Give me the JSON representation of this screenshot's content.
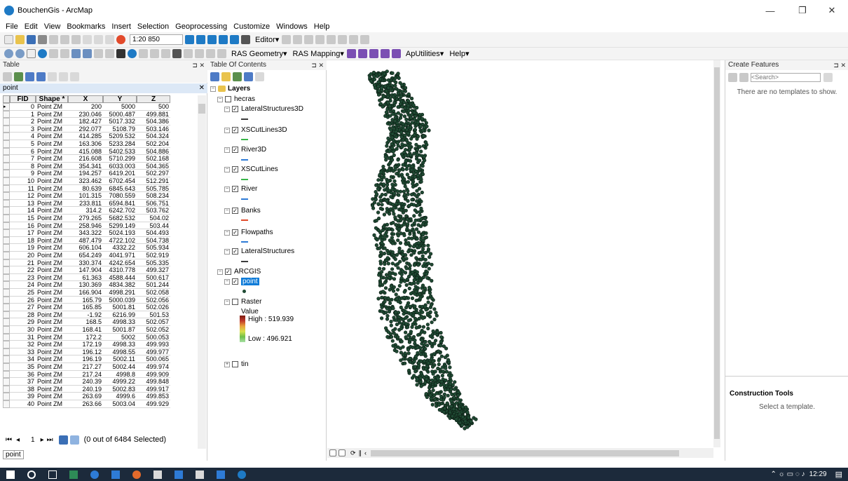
{
  "window": {
    "title": "BouchenGis - ArcMap",
    "minimize_glyph": "—",
    "maximize_glyph": "❐",
    "close_glyph": "✕"
  },
  "menu": [
    "File",
    "Edit",
    "View",
    "Bookmarks",
    "Insert",
    "Selection",
    "Geoprocessing",
    "Customize",
    "Windows",
    "Help"
  ],
  "toolbar": {
    "scale": "1:20 850",
    "editor_label": "Editor▾",
    "ras_geometry": "RAS Geometry▾",
    "ras_mapping": "RAS Mapping▾",
    "aputilities": "ApUtilities▾",
    "help": "Help▾"
  },
  "table_pane": {
    "title": "Table",
    "layer_tab": "point",
    "columns": [
      "FID",
      "Shape *",
      "X",
      "Y",
      "Z"
    ],
    "rows": [
      [
        "0",
        "Point ZM",
        "200",
        "5000",
        "500"
      ],
      [
        "1",
        "Point ZM",
        "230.046",
        "5000.487",
        "499.881"
      ],
      [
        "2",
        "Point ZM",
        "182.427",
        "5017.332",
        "504.386"
      ],
      [
        "3",
        "Point ZM",
        "292.077",
        "5108.79",
        "503.146"
      ],
      [
        "4",
        "Point ZM",
        "414.285",
        "5209.532",
        "504.324"
      ],
      [
        "5",
        "Point ZM",
        "163.306",
        "5233.284",
        "502.204"
      ],
      [
        "6",
        "Point ZM",
        "415.088",
        "5402.533",
        "504.886"
      ],
      [
        "7",
        "Point ZM",
        "216.608",
        "5710.299",
        "502.168"
      ],
      [
        "8",
        "Point ZM",
        "354.341",
        "6033.003",
        "504.365"
      ],
      [
        "9",
        "Point ZM",
        "194.257",
        "6419.201",
        "502.297"
      ],
      [
        "10",
        "Point ZM",
        "323.462",
        "6702.454",
        "512.291"
      ],
      [
        "11",
        "Point ZM",
        "80.639",
        "6845.643",
        "505.785"
      ],
      [
        "12",
        "Point ZM",
        "101.315",
        "7080.559",
        "508.234"
      ],
      [
        "13",
        "Point ZM",
        "233.811",
        "6594.841",
        "506.751"
      ],
      [
        "14",
        "Point ZM",
        "314.2",
        "6242.702",
        "503.762"
      ],
      [
        "15",
        "Point ZM",
        "279.265",
        "5682.532",
        "504.02"
      ],
      [
        "16",
        "Point ZM",
        "258.946",
        "5299.149",
        "503.44"
      ],
      [
        "17",
        "Point ZM",
        "343.322",
        "5024.193",
        "504.493"
      ],
      [
        "18",
        "Point ZM",
        "487.479",
        "4722.102",
        "504.738"
      ],
      [
        "19",
        "Point ZM",
        "606.104",
        "4332.22",
        "505.934"
      ],
      [
        "20",
        "Point ZM",
        "654.249",
        "4041.971",
        "502.919"
      ],
      [
        "21",
        "Point ZM",
        "330.374",
        "4242.654",
        "505.335"
      ],
      [
        "22",
        "Point ZM",
        "147.904",
        "4310.778",
        "499.327"
      ],
      [
        "23",
        "Point ZM",
        "61.363",
        "4588.444",
        "500.617"
      ],
      [
        "24",
        "Point ZM",
        "130.369",
        "4834.382",
        "501.244"
      ],
      [
        "25",
        "Point ZM",
        "166.904",
        "4998.291",
        "502.058"
      ],
      [
        "26",
        "Point ZM",
        "165.79",
        "5000.039",
        "502.056"
      ],
      [
        "27",
        "Point ZM",
        "165.85",
        "5001.81",
        "502.026"
      ],
      [
        "28",
        "Point ZM",
        "-1.92",
        "6216.99",
        "501.53"
      ],
      [
        "29",
        "Point ZM",
        "168.5",
        "4998.33",
        "502.057"
      ],
      [
        "30",
        "Point ZM",
        "168.41",
        "5001.87",
        "502.052"
      ],
      [
        "31",
        "Point ZM",
        "172.2",
        "5002",
        "500.053"
      ],
      [
        "32",
        "Point ZM",
        "172.19",
        "4998.33",
        "499.993"
      ],
      [
        "33",
        "Point ZM",
        "196.12",
        "4998.55",
        "499.977"
      ],
      [
        "34",
        "Point ZM",
        "196.19",
        "5002.11",
        "500.065"
      ],
      [
        "35",
        "Point ZM",
        "217.27",
        "5002.44",
        "499.974"
      ],
      [
        "36",
        "Point ZM",
        "217.24",
        "4998.8",
        "499.909"
      ],
      [
        "37",
        "Point ZM",
        "240.39",
        "4999.22",
        "499.848"
      ],
      [
        "38",
        "Point ZM",
        "240.19",
        "5002.83",
        "499.917"
      ],
      [
        "39",
        "Point ZM",
        "263.69",
        "4999.6",
        "499.853"
      ],
      [
        "40",
        "Point ZM",
        "263.66",
        "5003.04",
        "499.929"
      ]
    ],
    "record_current": "1",
    "selection_status": "(0 out of 6484 Selected)",
    "bottom_tab": "point"
  },
  "toc": {
    "title": "Table Of Contents",
    "root": "Layers",
    "groups": [
      {
        "name": "hecras",
        "checked": false,
        "layers": [
          {
            "name": "LateralStructures3D",
            "color": "#3c3c3c"
          },
          {
            "name": "XSCutLines3D",
            "color": "#39b54a"
          },
          {
            "name": "River3D",
            "color": "#2e7bd6"
          },
          {
            "name": "XSCutLines",
            "color": "#39b54a"
          },
          {
            "name": "River",
            "color": "#2e7bd6"
          },
          {
            "name": "Banks",
            "color": "#e24a2b"
          },
          {
            "name": "Flowpaths",
            "color": "#2e7bd6"
          },
          {
            "name": "LateralStructures",
            "color": "#3c3c3c"
          }
        ]
      },
      {
        "name": "ARCGIS",
        "checked": true
      }
    ],
    "point_layer": "point",
    "raster_layer": "Raster",
    "raster_value_label": "Value",
    "raster_high": "High : 519.939",
    "raster_low": "Low : 496.921",
    "tin_layer": "tin"
  },
  "create_features": {
    "title": "Create Features",
    "search_placeholder": "<Search>",
    "empty_message": "There are no templates to show.",
    "construction_tools": "Construction Tools",
    "select_template": "Select a template."
  },
  "taskbar": {
    "time": "12:29"
  },
  "colors": {
    "accent_blue": "#1e7ac5",
    "point_fill": "#1f4a33",
    "point_stroke": "#0b1a12",
    "selection_highlight": "#0e7bd8",
    "taskbar": "#1c2a3b"
  }
}
